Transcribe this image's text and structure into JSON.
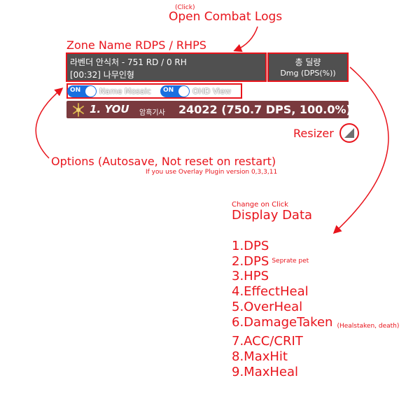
{
  "annotations": {
    "click_note": "(Click)",
    "open_logs": "Open Combat Logs",
    "zone_label": "Zone Name  RDPS / RHPS",
    "resizer": "Resizer",
    "options": "Options (Autosave, Not reset on restart)",
    "plugin_note": "If you use Overlay Plugin version 0,3,3,11",
    "change_note": "Change on Click",
    "display_data": "Display Data",
    "display_items": [
      {
        "text": "1.DPS",
        "note": ""
      },
      {
        "text": "2.DPS",
        "note": "Seprate pet"
      },
      {
        "text": "3.HPS",
        "note": ""
      },
      {
        "text": "4.EffectHeal",
        "note": ""
      },
      {
        "text": "5.OverHeal",
        "note": ""
      },
      {
        "text": "6.DamageTaken",
        "note": "(Healstaken, death)"
      },
      {
        "text": "7.ACC/CRIT",
        "note": ""
      },
      {
        "text": "8.MaxHit",
        "note": ""
      },
      {
        "text": "9.MaxHeal",
        "note": ""
      }
    ]
  },
  "overlay": {
    "zone_line": "라벤더 안식처 - 751 RD / 0 RH",
    "encounter_line": "[00:32] 나무인형",
    "total_title": "총 딜량",
    "total_sub": "Dmg (DPS(%))",
    "options": [
      {
        "state": "ON",
        "label": "Name Mosaic"
      },
      {
        "state": "ON",
        "label": "OHD View"
      }
    ],
    "row": {
      "rank_name": "1. YOU",
      "job": "암흑기사",
      "damage": "24022 (750.7 DPS, 100.0%)"
    }
  },
  "colors": {
    "annotation": "#e8141c",
    "header_bg": "#505050",
    "row_bg": "#7a3a3e",
    "toggle_on": "#1a6fe0"
  },
  "icons": {
    "job": "dark-knight-job-icon",
    "resizer": "resize-handle-icon"
  }
}
